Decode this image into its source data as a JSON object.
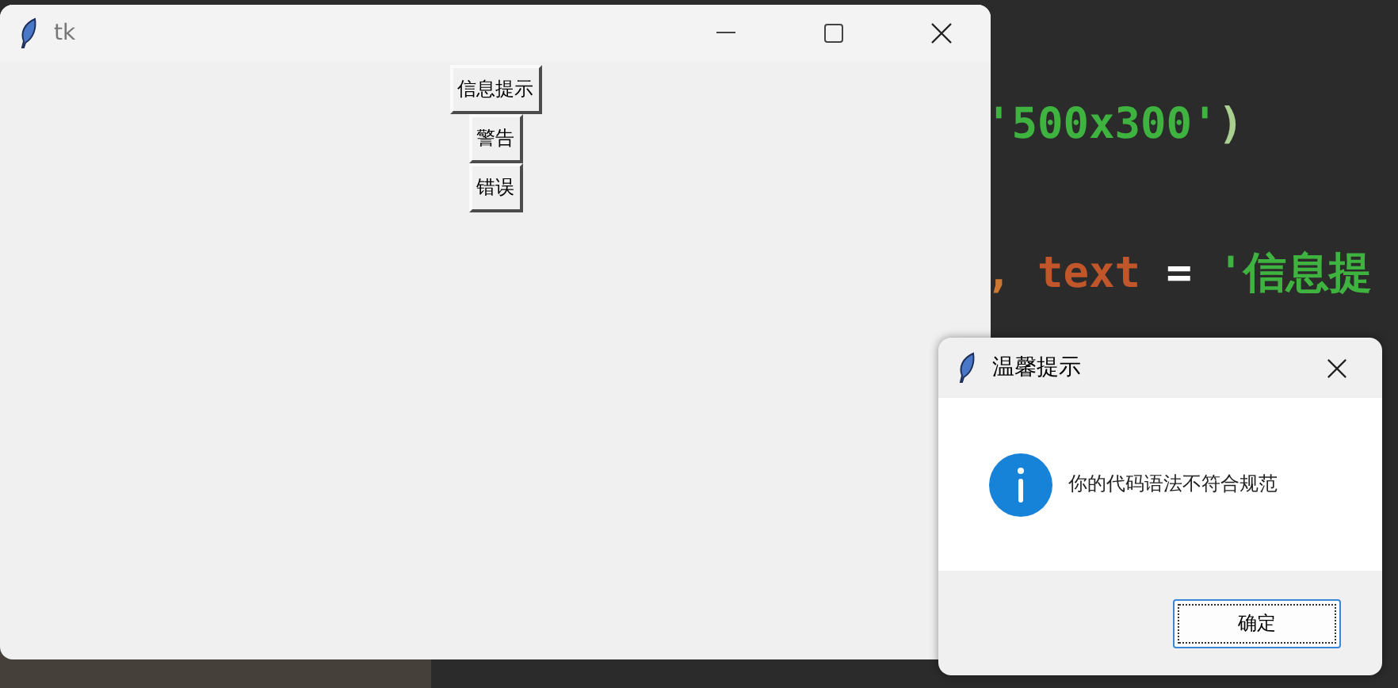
{
  "editor": {
    "code_lines": [
      {
        "tokens": [
          {
            "text": "'500x300'",
            "kind": "string"
          },
          {
            "text": ")",
            "kind": "paren"
          }
        ]
      },
      {
        "tokens": [
          {
            "text": ", ",
            "kind": "punct"
          },
          {
            "text": "text",
            "kind": "keyword"
          },
          {
            "text": " = ",
            "kind": "operator"
          },
          {
            "text": "'信息提",
            "kind": "string"
          }
        ]
      }
    ]
  },
  "main_window": {
    "title": "tk",
    "buttons": [
      "信息提示",
      "警告",
      "错误"
    ]
  },
  "dialog": {
    "title": "温馨提示",
    "message": "你的代码语法不符合规范",
    "ok_button": "确定"
  }
}
